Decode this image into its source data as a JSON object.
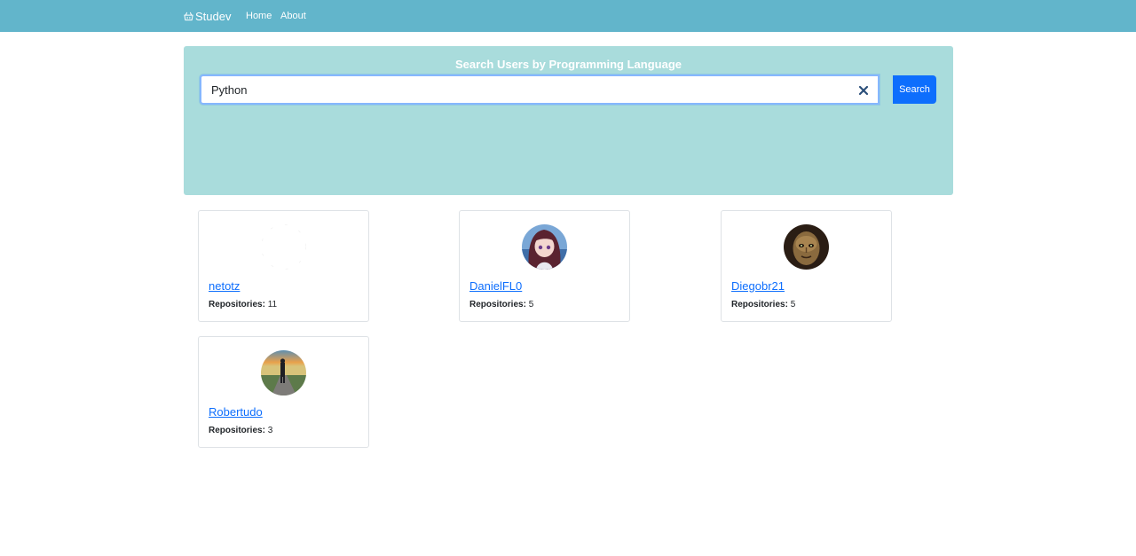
{
  "nav": {
    "brand_icon": "basket-icon",
    "brand": "Studev",
    "links": [
      "Home",
      "About"
    ]
  },
  "search": {
    "title": "Search Users by Programming Language",
    "value": "Python",
    "button_label": "Search",
    "clear_icon": "close-icon"
  },
  "colors": {
    "navbar": "#62b5cb",
    "panel": "#a9dcdc",
    "primary": "#0d6efd"
  },
  "users": [
    {
      "username": "netotz",
      "repos_label": "Repositories:",
      "repos": "11",
      "avatar": "blank-avatar"
    },
    {
      "username": "DanielFL0",
      "repos_label": "Repositories:",
      "repos": "5",
      "avatar": "anime-girl-avatar"
    },
    {
      "username": "Diegobr21",
      "repos_label": "Repositories:",
      "repos": "5",
      "avatar": "mask-face-avatar"
    },
    {
      "username": "Robertudo",
      "repos_label": "Repositories:",
      "repos": "3",
      "avatar": "sunset-road-avatar"
    }
  ]
}
